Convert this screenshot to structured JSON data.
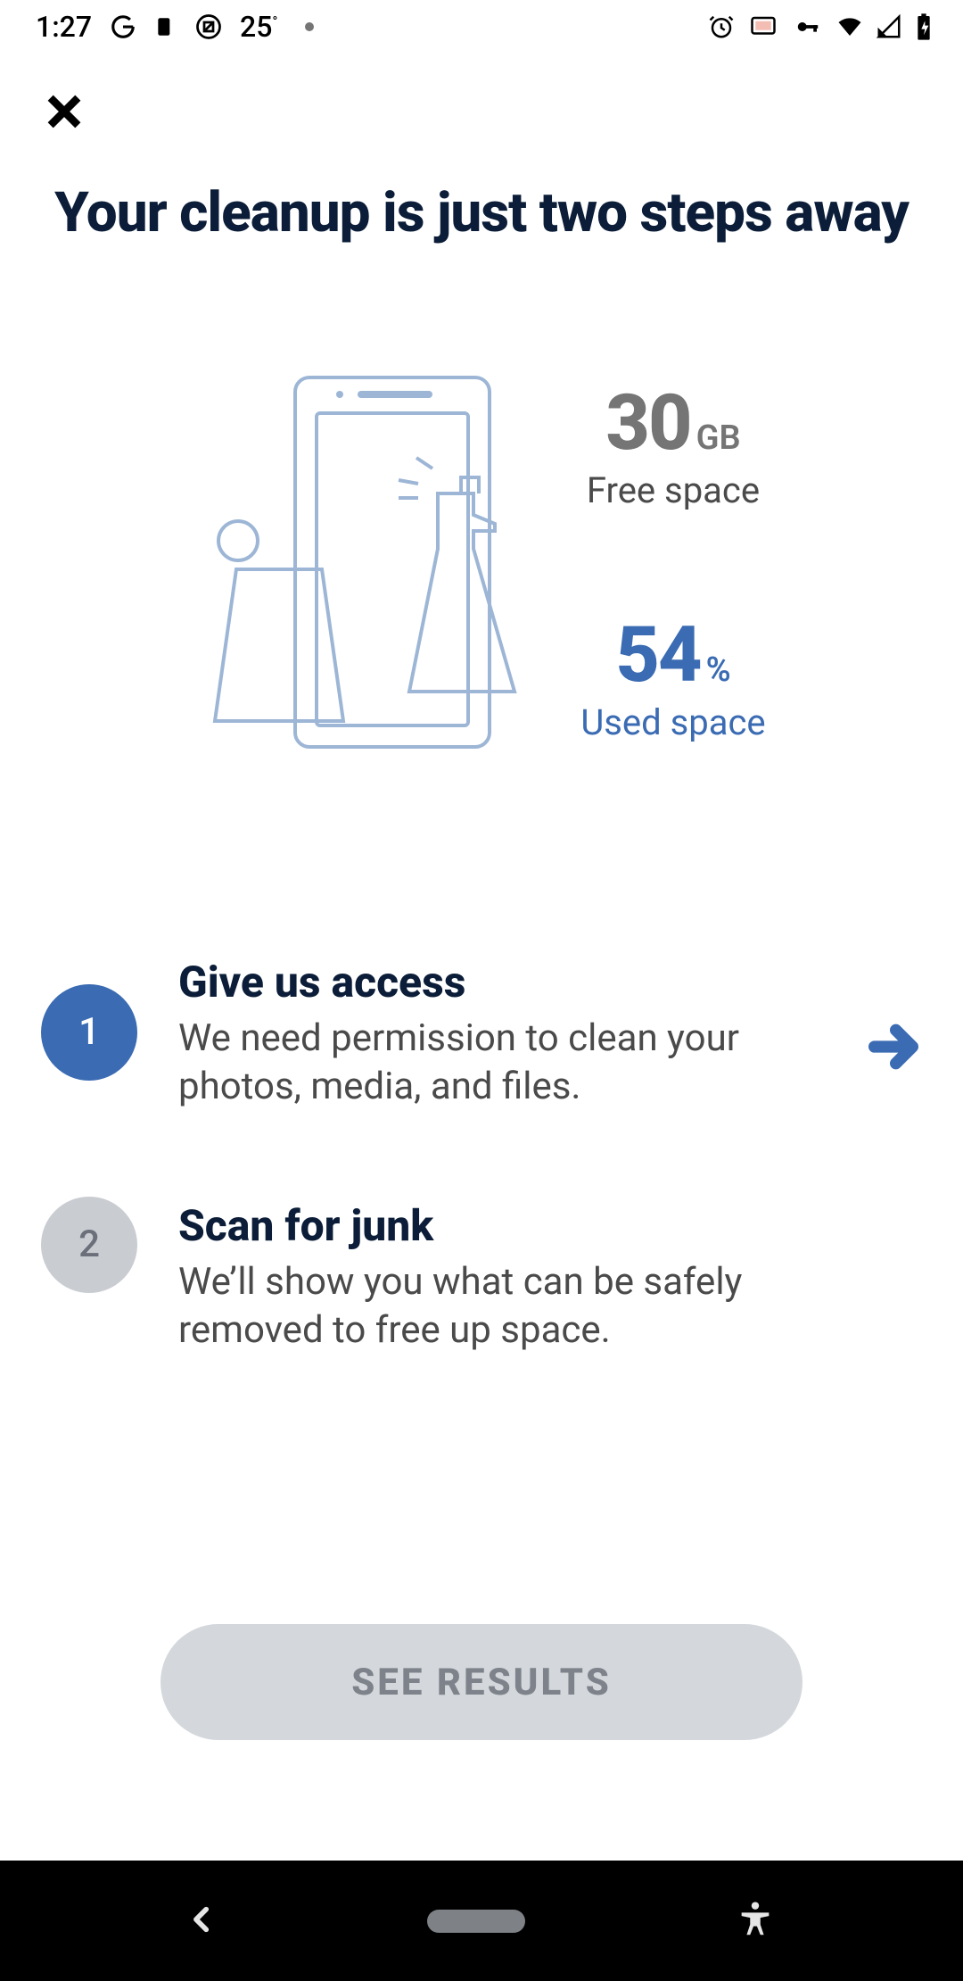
{
  "status_bar": {
    "time": "1:27",
    "temperature": "25",
    "temperature_unit": "°"
  },
  "heading": "Your cleanup is just two steps away",
  "stats": {
    "free": {
      "value": "30",
      "unit": "GB",
      "label": "Free space"
    },
    "used": {
      "value": "54",
      "unit": "%",
      "label": "Used space"
    }
  },
  "steps": [
    {
      "number": "1",
      "title": "Give us access",
      "description": "We need permission to clean your photos, media, and files.",
      "active": true,
      "has_arrow": true
    },
    {
      "number": "2",
      "title": "Scan for junk",
      "description": "We’ll show you what can be safely removed to free up space.",
      "active": false,
      "has_arrow": false
    }
  ],
  "cta_label": "SEE RESULTS",
  "colors": {
    "accent": "#3a6bb3",
    "muted": "#757575",
    "disabled_bg": "#d4d7db",
    "disabled_fg": "#7e838b"
  }
}
